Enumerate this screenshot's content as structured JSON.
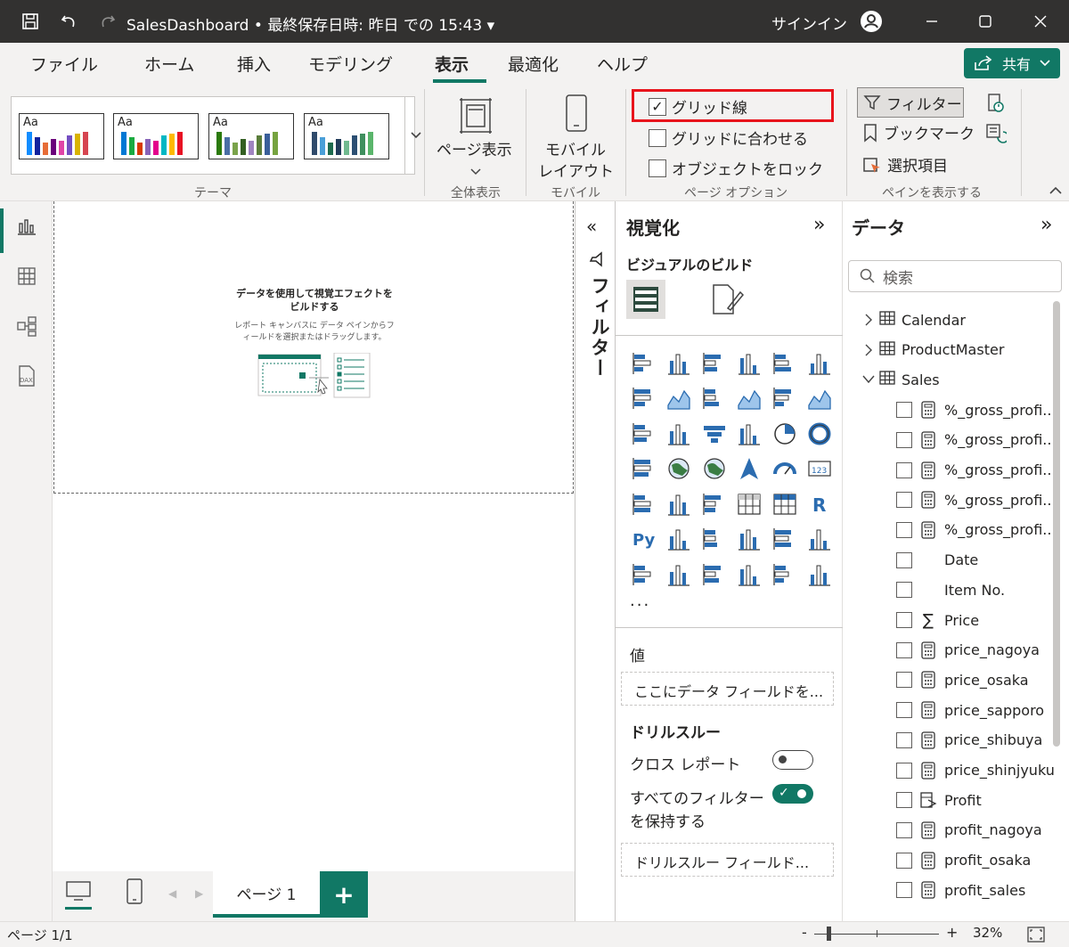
{
  "titlebar": {
    "title": "SalesDashboard • 最終保存日時: 昨日 での 15:43 ▾",
    "signin": "サインイン"
  },
  "menu": {
    "items": [
      "ファイル",
      "ホーム",
      "挿入",
      "モデリング",
      "表示",
      "最適化",
      "ヘルプ"
    ],
    "active": "表示",
    "share": "共有"
  },
  "ribbon": {
    "themes_label": "テーマ",
    "theme_aa": "Aa",
    "page_view": "ページ表示",
    "page_view_group": "全体表示",
    "mobile_layout_line1": "モバイル",
    "mobile_layout_line2": "レイアウト",
    "mobile_group": "モバイル",
    "gridlines": "グリッド線",
    "snap_to_grid": "グリッドに合わせる",
    "lock_objects": "オブジェクトをロック",
    "page_options_group": "ページ オプション",
    "filters": "フィルター",
    "bookmarks": "ブックマーク",
    "selection": "選択項目",
    "show_panes_group": "ペインを表示する"
  },
  "canvas": {
    "empty_title_line1": "データを使用して視覚エフェクトを",
    "empty_title_line2": "ビルドする",
    "empty_sub_line1": "レポート キャンバスに データ ペインからフ",
    "empty_sub_line2": "ィールドを選択またはドラッグします。"
  },
  "pages": {
    "tab": "ページ 1"
  },
  "filter_pane": {
    "label": "フィルター"
  },
  "viz": {
    "title": "視覚化",
    "build": "ビジュアルのビルド",
    "more": "...",
    "values_label": "値",
    "values_placeholder": "ここにデータ フィールドを...",
    "drillthrough": "ドリルスルー",
    "cross_report": "クロス レポート",
    "keep_filters_line1": "すべてのフィルター",
    "keep_filters_line2": "を保持する",
    "drill_placeholder": "ドリルスルー フィールド..."
  },
  "data": {
    "title": "データ",
    "search_placeholder": "検索",
    "tables": [
      {
        "name": "Calendar",
        "expanded": false
      },
      {
        "name": "ProductMaster",
        "expanded": false
      },
      {
        "name": "Sales",
        "expanded": true
      }
    ],
    "fields": [
      {
        "name": "%_gross_profi...",
        "icon": "measure"
      },
      {
        "name": "%_gross_profi...",
        "icon": "measure"
      },
      {
        "name": "%_gross_profi...",
        "icon": "measure"
      },
      {
        "name": "%_gross_profi...",
        "icon": "measure"
      },
      {
        "name": "%_gross_profi...",
        "icon": "measure"
      },
      {
        "name": "Date",
        "icon": "none"
      },
      {
        "name": "Item No.",
        "icon": "none"
      },
      {
        "name": "Price",
        "icon": "sum"
      },
      {
        "name": "price_nagoya",
        "icon": "measure"
      },
      {
        "name": "price_osaka",
        "icon": "measure"
      },
      {
        "name": "price_sapporo",
        "icon": "measure"
      },
      {
        "name": "price_shibuya",
        "icon": "measure"
      },
      {
        "name": "price_shinjyuku",
        "icon": "measure"
      },
      {
        "name": "Profit",
        "icon": "calc-column"
      },
      {
        "name": "profit_nagoya",
        "icon": "measure"
      },
      {
        "name": "profit_osaka",
        "icon": "measure"
      },
      {
        "name": "profit_sales",
        "icon": "measure"
      }
    ]
  },
  "status": {
    "page": "ページ 1/1",
    "zoom": "32%"
  },
  "colors": {
    "accent": "#117865",
    "highlight_border": "#e8141c",
    "titlebar": "#323130"
  }
}
